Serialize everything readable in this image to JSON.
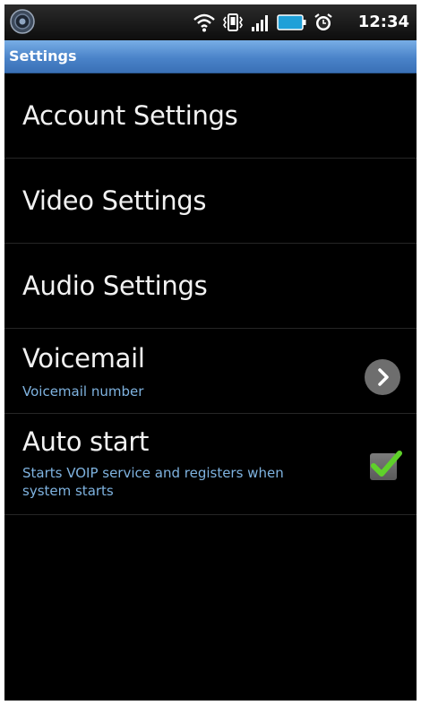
{
  "status_bar": {
    "time": "12:34",
    "icons": [
      "wifi-icon",
      "vibrate-icon",
      "signal-icon",
      "battery-icon",
      "alarm-icon"
    ]
  },
  "title_bar": {
    "title": "Settings"
  },
  "menu": {
    "items": [
      {
        "label": "Account Settings"
      },
      {
        "label": "Video Settings"
      },
      {
        "label": "Audio Settings"
      },
      {
        "label": "Voicemail",
        "summary": "Voicemail number",
        "icon": "chevron-right-icon"
      },
      {
        "label": "Auto start",
        "summary": "Starts VOIP service and registers when system starts",
        "checked": true
      }
    ]
  },
  "colors": {
    "title_bar": "#4a83c9",
    "summary_text": "#7fb3e0",
    "check_mark": "#5fd12a"
  }
}
